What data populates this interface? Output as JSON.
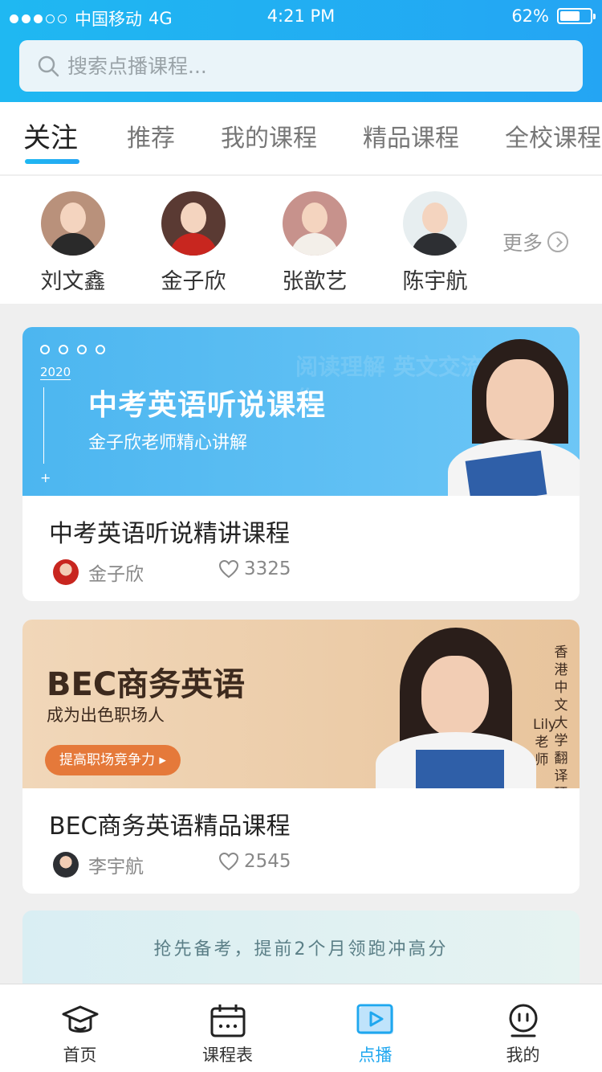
{
  "status_bar": {
    "carrier": "中国移动",
    "network": "4G",
    "time": "4:21 PM",
    "battery": "62%",
    "battery_level": 0.62,
    "signal_bars_filled": 3,
    "signal_bars_total": 5
  },
  "search": {
    "placeholder": "搜索点播课程..."
  },
  "tabs": [
    {
      "label": "关注",
      "active": true
    },
    {
      "label": "推荐",
      "active": false
    },
    {
      "label": "我的课程",
      "active": false
    },
    {
      "label": "精品课程",
      "active": false
    },
    {
      "label": "全校课程",
      "active": false
    }
  ],
  "teachers": [
    {
      "name": "刘文鑫"
    },
    {
      "name": "金子欣"
    },
    {
      "name": "张歆艺"
    },
    {
      "name": "陈宇航"
    }
  ],
  "more_label": "更多",
  "courses": [
    {
      "banner": {
        "year": "2020",
        "headline": "中考英语听说课程",
        "subline": "金子欣老师精心讲解",
        "ghost": "阅读理解 英文交流 英文写作"
      },
      "title": "中考英语听说精讲课程",
      "teacher": "金子欣",
      "likes": "3325"
    },
    {
      "banner": {
        "headline": "BEC商务英语",
        "subline": "成为出色职场人",
        "button": "提高职场竞争力 ▸",
        "vertical_1": "香港中文大学翻译硕士",
        "vertical_2": "Lily老师"
      },
      "title": "BEC商务英语精品课程",
      "teacher": "李宇航",
      "likes": "2545"
    }
  ],
  "peek_card": {
    "text": "抢先备考，提前2个月领跑冲高分"
  },
  "bottom_nav": [
    {
      "label": "首页",
      "icon": "graduation-cap-icon",
      "active": false
    },
    {
      "label": "课程表",
      "icon": "calendar-icon",
      "active": false
    },
    {
      "label": "点播",
      "icon": "play-icon",
      "active": true
    },
    {
      "label": "我的",
      "icon": "profile-face-icon",
      "active": false
    }
  ],
  "colors": {
    "accent": "#1fa7ef",
    "header_start": "#1fb8f2",
    "header_end": "#24a5f3",
    "banner1": "#4cb6f0",
    "banner2": "#f1d7b9",
    "button_orange": "#e5793a"
  }
}
